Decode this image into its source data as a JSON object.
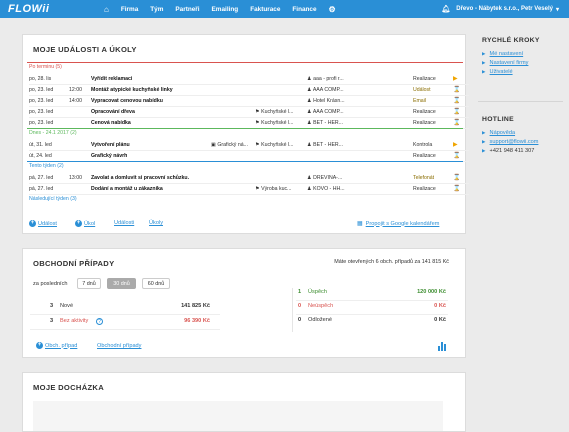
{
  "app": {
    "logo": "FLOWii",
    "nav": [
      "Firma",
      "Tým",
      "Partneři",
      "Emailing",
      "Fakturace",
      "Finance"
    ],
    "company": "Dřevo - Nábytek s.r.o., Petr Veselý"
  },
  "events": {
    "title": "MOJE UDÁLOSTI A ÚKOLY",
    "groups": [
      {
        "label": "Po terminu (5)",
        "color": "#d9534f",
        "rows": [
          {
            "date": "po, 28. lis",
            "time": "",
            "title": "Vyřídit reklamaci",
            "c1": "",
            "c2": "",
            "person": "aaa - profi r...",
            "type": "Realizace",
            "icon": "flag-icon",
            "iconColor": "#f0a500",
            "typeColor": "#333"
          },
          {
            "date": "po, 23. led",
            "time": "12:00",
            "title": "Montáž atypické kuchyňské linky",
            "c1": "",
            "c2": "",
            "person": "AAA COMP...",
            "type": "Událost",
            "icon": "hourglass-icon",
            "iconColor": "#2a8fd6",
            "typeColor": "#8a6d00"
          },
          {
            "date": "po, 23. led",
            "time": "14:00",
            "title": "Vypracovat cenovou nabídku",
            "c1": "",
            "c2": "",
            "person": "Hotel Krásn...",
            "type": "Email",
            "icon": "hourglass-icon",
            "iconColor": "#2a8fd6",
            "typeColor": "#8a6d00"
          },
          {
            "date": "po, 23. led",
            "time": "",
            "title": "Opracování dřeva",
            "c1": "",
            "c2": "Kuchyňské l...",
            "person": "AAA COMP...",
            "type": "Realizace",
            "icon": "hourglass-icon",
            "iconColor": "#2a8fd6",
            "typeColor": "#333"
          },
          {
            "date": "po, 23. led",
            "time": "",
            "title": "Cenová nabídka",
            "c1": "",
            "c2": "Kuchyňské l...",
            "person": "BET - HER...",
            "type": "Realizace",
            "icon": "hourglass-icon",
            "iconColor": "#2a8fd6",
            "typeColor": "#333"
          }
        ]
      },
      {
        "label": "Dnes - 24.1 2017 (2)",
        "color": "#5cb85c",
        "rows": [
          {
            "date": "út, 31. led",
            "time": "",
            "title": "Vytvoření plánu",
            "c1": "Grafický ná...",
            "c2": "Kuchyňské l...",
            "person": "BET - HER...",
            "type": "Kontrola",
            "icon": "flag-icon",
            "iconColor": "#f0a500",
            "typeColor": "#333"
          },
          {
            "date": "út, 24. led",
            "time": "",
            "title": "Grafický návrh",
            "c1": "",
            "c2": "",
            "person": "",
            "type": "Realizace",
            "icon": "hourglass-icon",
            "iconColor": "#2a8fd6",
            "typeColor": "#333"
          }
        ]
      },
      {
        "label": "Tento týden (2)",
        "color": "#2a8fd6",
        "rows": [
          {
            "date": "pá, 27. led",
            "time": "13:00",
            "title": "Zavolat a domluvit si pracovní schůzku.",
            "c1": "",
            "c2": "",
            "person": "DREVINA-...",
            "type": "Telefonát",
            "icon": "hourglass-icon",
            "iconColor": "#2a8fd6",
            "typeColor": "#8a6d00"
          },
          {
            "date": "pá, 27. led",
            "time": "",
            "title": "Dodání a montáž u zákazníka",
            "c1": "",
            "c2": "Výroba kuc...",
            "person": "KOVO - HH...",
            "type": "Realizace",
            "icon": "hourglass-icon",
            "iconColor": "#2a8fd6",
            "typeColor": "#333"
          }
        ]
      }
    ],
    "next_week": "Následující týden (3)",
    "footer": {
      "add_event": "Událost",
      "add_task": "Úkol",
      "events_link": "Události",
      "tasks_link": "Úkoly",
      "google": "Propojit s Google kalendářem"
    }
  },
  "deals": {
    "title": "OBCHODNÍ PŘÍPADY",
    "summary": "Máte otevřených 6 obch. případů za 141 815 Kč",
    "period_label": "za posledních",
    "periods": [
      "7 dnů",
      "30 dnů",
      "60 dnů"
    ],
    "left": [
      {
        "count": "3",
        "label": "Nové",
        "value": "141 825 Kč",
        "color": "#333"
      },
      {
        "count": "3",
        "label": "Bez aktivity",
        "value": "96 390 Kč",
        "color": "#d9534f"
      }
    ],
    "right": [
      {
        "count": "1",
        "label": "Úspěch",
        "value": "120 000 Kč",
        "color": "#3c8d2f"
      },
      {
        "count": "0",
        "label": "Neúspěch",
        "value": "0 Kč",
        "color": "#d9534f"
      },
      {
        "count": "0",
        "label": "Odložené",
        "value": "0 Kč",
        "color": "#333"
      }
    ],
    "footer": {
      "add": "Obch. případ",
      "link": "Obchodní případy"
    }
  },
  "attendance": {
    "title": "MOJE DOCHÁZKA"
  },
  "quick": {
    "title": "RYCHLÉ KROKY",
    "items": [
      "Mé nastavení",
      "Nastavení firmy",
      "Uživatelé"
    ]
  },
  "hotline": {
    "title": "HOTLINE",
    "items": [
      "Nápověda",
      "support@flowii.com",
      "+421 948 411 307"
    ]
  }
}
